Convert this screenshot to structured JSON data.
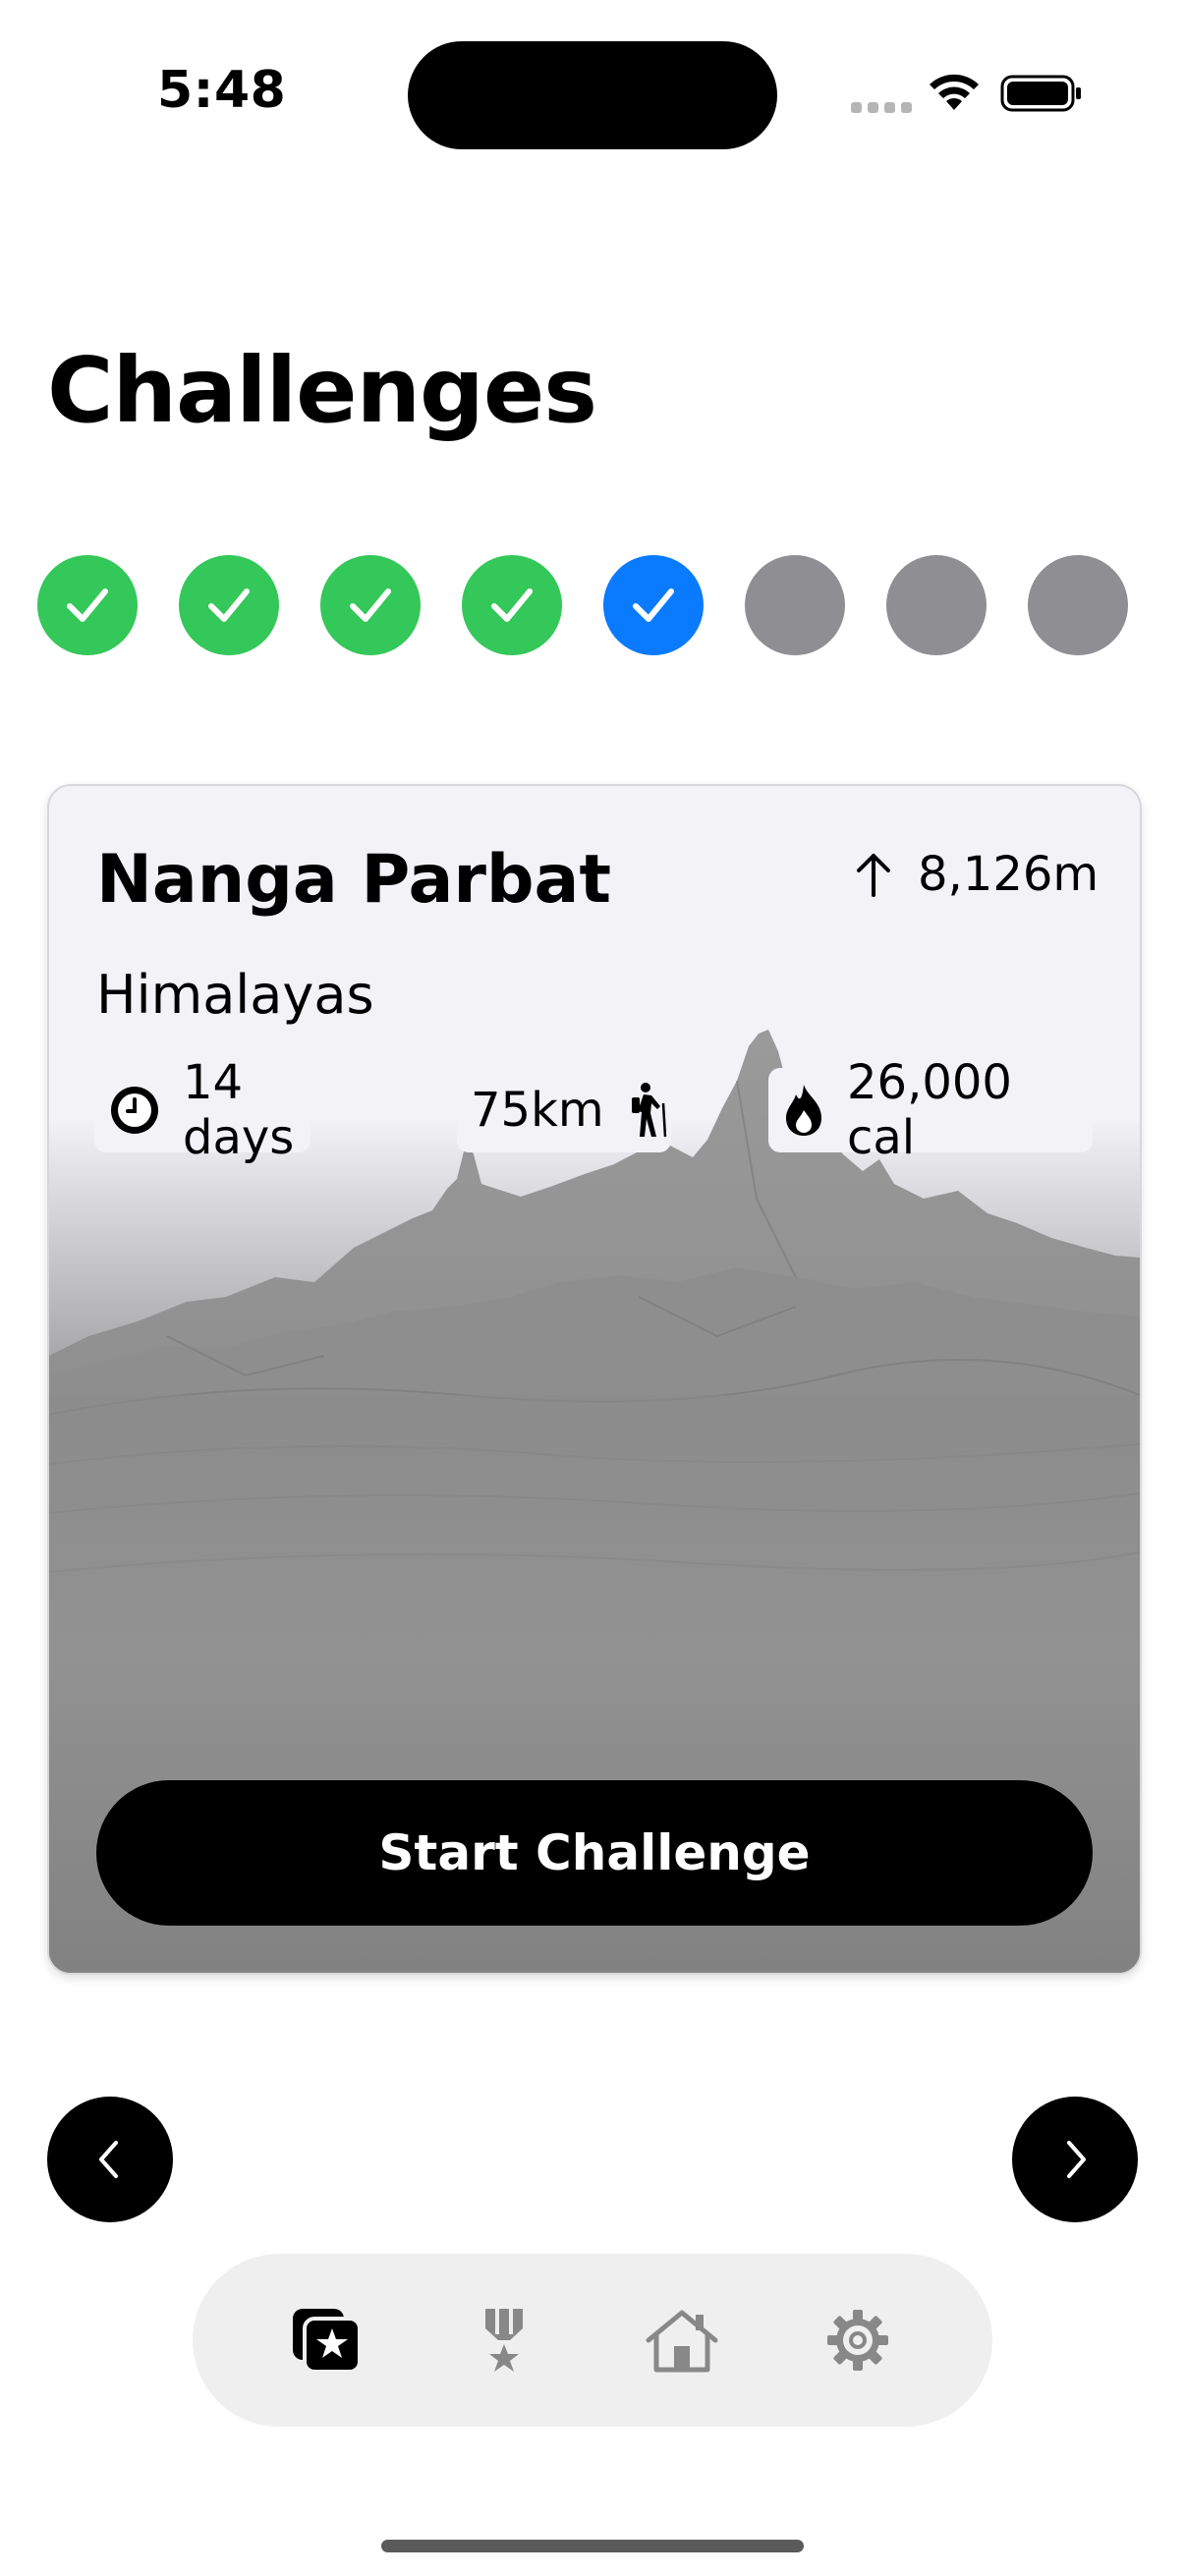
{
  "status_bar": {
    "time": "5:48"
  },
  "header": {
    "title": "Challenges"
  },
  "progress": {
    "steps": [
      {
        "state": "completed"
      },
      {
        "state": "completed"
      },
      {
        "state": "completed"
      },
      {
        "state": "completed"
      },
      {
        "state": "current"
      },
      {
        "state": "locked"
      },
      {
        "state": "locked"
      },
      {
        "state": "locked"
      }
    ]
  },
  "challenge": {
    "name": "Nanga Parbat",
    "range": "Himalayas",
    "altitude": "8,126m",
    "duration": "14 days",
    "distance": "75km",
    "calories": "26,000 cal",
    "start_label": "Start Challenge"
  },
  "icons": {
    "altitude": "arrow-up-icon",
    "duration": "clock-icon",
    "distance": "hiker-icon",
    "calories": "flame-icon",
    "prev": "chevron-left-icon",
    "next": "chevron-right-icon",
    "tabs": [
      "challenges-star-icon",
      "medal-icon",
      "house-icon",
      "gear-icon"
    ]
  },
  "colors": {
    "completed": "#34c759",
    "current": "#0a7aff",
    "locked": "#8e8e93",
    "button": "#000000"
  }
}
